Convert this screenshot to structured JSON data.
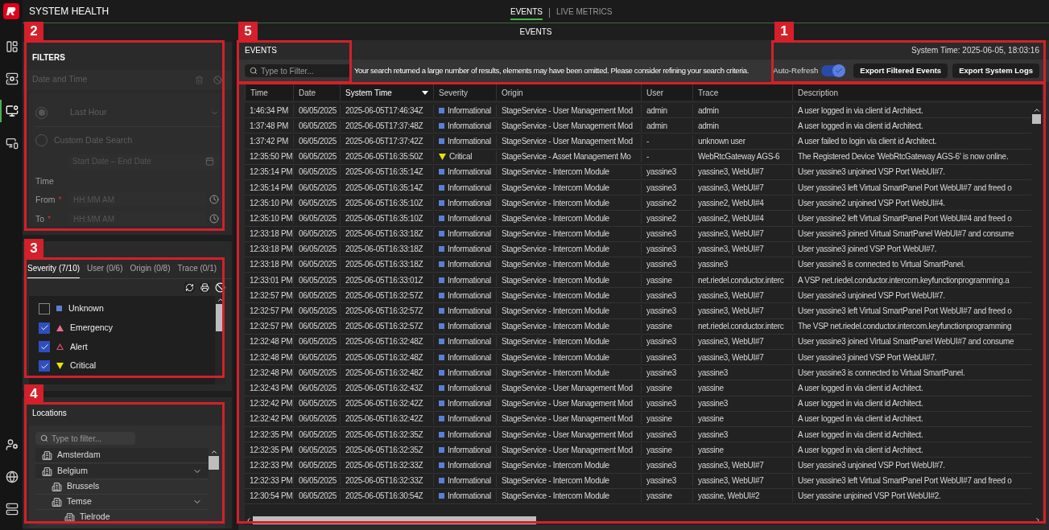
{
  "app": {
    "title": "SYSTEM HEALTH"
  },
  "nav_rail": {
    "top": [
      {
        "selected": false
      },
      {
        "selected": false
      },
      {
        "selected": true
      },
      {
        "selected": false
      }
    ],
    "bottom": [
      {
        "selected": false
      },
      {
        "selected": false
      },
      {
        "selected": false
      }
    ]
  },
  "top_tabs": [
    {
      "label": "EVENTS",
      "selected": true
    },
    {
      "label": "LIVE METRICS",
      "selected": false
    }
  ],
  "section_bar": {
    "title": "EVENTS"
  },
  "filters": {
    "title": "FILTERS",
    "date_time": {
      "label": "Date and Time",
      "disabled": true,
      "options": [
        {
          "label": "Last Hour",
          "selected": true,
          "kind": "dropdown"
        },
        {
          "label": "Custom Date Search",
          "selected": false,
          "kind": "plain"
        }
      ],
      "date_range": {
        "placeholder": "Start Date – End Date"
      },
      "time_label": "Time",
      "from": {
        "label": "From",
        "required_mark": "*",
        "placeholder": "HH:MM AM"
      },
      "to": {
        "label": "To",
        "required_mark": "*",
        "placeholder": "HH:MM AM"
      }
    }
  },
  "severity_filter": {
    "tabs": [
      {
        "label": "Severity (7/10)",
        "selected": true
      },
      {
        "label": "User (0/6)",
        "selected": false
      },
      {
        "label": "Origin (0/8)",
        "selected": false
      },
      {
        "label": "Trace (0/1)",
        "selected": false
      }
    ],
    "items": [
      {
        "label": "Unknown",
        "checked": false,
        "kind": "square",
        "color": "#5b7fd6"
      },
      {
        "label": "Emergency",
        "checked": true,
        "kind": "triangle",
        "color": "#f06a8a"
      },
      {
        "label": "Alert",
        "checked": true,
        "kind": "triangle-outline",
        "color": "#e0506a"
      },
      {
        "label": "Critical",
        "checked": true,
        "kind": "triangle-down",
        "color": "#e6e600"
      }
    ]
  },
  "locations": {
    "title": "Locations",
    "search": {
      "placeholder": "Type to filter..."
    },
    "tree": [
      {
        "label": "Amsterdam",
        "expanded": false
      },
      {
        "label": "Belgium",
        "expanded": true,
        "children": [
          {
            "label": "Brussels",
            "expanded": false
          },
          {
            "label": "Temse",
            "expanded": true,
            "children": [
              {
                "label": "Tielrode",
                "expanded": false
              }
            ]
          }
        ]
      }
    ]
  },
  "events": {
    "title": "EVENTS",
    "system_time": "System Time: 2025-06-05, 18:03:16",
    "filter": {
      "placeholder": "Type to Filter..."
    },
    "warning": "Your search returned a large number of results, elements may have been omitted. Please consider refining your search criteria.",
    "auto_refresh": {
      "label": "Auto-Refresh",
      "on": true
    },
    "buttons": [
      "Export Filtered Events",
      "Export System Logs"
    ],
    "columns": [
      {
        "label": "Time",
        "sorted": false
      },
      {
        "label": "Date",
        "sorted": false
      },
      {
        "label": "System Time",
        "sorted": true
      },
      {
        "label": "Severity",
        "sorted": false
      },
      {
        "label": "Origin",
        "sorted": false
      },
      {
        "label": "User",
        "sorted": false
      },
      {
        "label": "Trace",
        "sorted": false
      },
      {
        "label": "Description",
        "sorted": false
      }
    ],
    "rows": [
      {
        "cells": [
          "1:46:34 PM",
          "06/05/2025",
          "2025-06-05T17:46:34Z",
          "Informational",
          "StageService - User Management Mod",
          "admin",
          "admin",
          "A user logged in via client id Architect."
        ],
        "kind": "square",
        "color": "#5b7fd6"
      },
      {
        "cells": [
          "1:37:48 PM",
          "06/05/2025",
          "2025-06-05T17:37:48Z",
          "Informational",
          "StageService - User Management Mod",
          "admin",
          "admin",
          "A user logged in via client id Architect."
        ],
        "kind": "square",
        "color": "#5b7fd6"
      },
      {
        "cells": [
          "1:37:42 PM",
          "06/05/2025",
          "2025-06-05T17:37:42Z",
          "Informational",
          "StageService - User Management Mod",
          "-",
          "unknown user",
          "A user failed to login via client id Architect."
        ],
        "kind": "square",
        "color": "#5b7fd6"
      },
      {
        "cells": [
          "12:35:50 PM",
          "06/05/2025",
          "2025-06-05T16:35:50Z",
          "Critical",
          "StageService - Asset Management Mo",
          "-",
          "WebRtcGateway AGS-6",
          "The Registered Device 'WebRtcGateway AGS-6' is now online."
        ],
        "kind": "triangle-down",
        "color": "#e6e600"
      },
      {
        "cells": [
          "12:35:14 PM",
          "06/05/2025",
          "2025-06-05T16:35:14Z",
          "Informational",
          "StageService - Intercom Module",
          "yassine3",
          "yassine3, WebUI#7",
          "User yassine3 unjoined VSP Port WebUI#7."
        ],
        "kind": "square",
        "color": "#5b7fd6"
      },
      {
        "cells": [
          "12:35:14 PM",
          "06/05/2025",
          "2025-06-05T16:35:14Z",
          "Informational",
          "StageService - Intercom Module",
          "yassine3",
          "yassine3, WebUI#7",
          "User yassine3 left Virtual SmartPanel Port WebUI#7 and freed o"
        ],
        "kind": "square",
        "color": "#5b7fd6"
      },
      {
        "cells": [
          "12:35:10 PM",
          "06/05/2025",
          "2025-06-05T16:35:10Z",
          "Informational",
          "StageService - Intercom Module",
          "yassine2",
          "yassine2, WebUI#4",
          "User yassine2 unjoined VSP Port WebUI#4."
        ],
        "kind": "square",
        "color": "#5b7fd6"
      },
      {
        "cells": [
          "12:35:10 PM",
          "06/05/2025",
          "2025-06-05T16:35:10Z",
          "Informational",
          "StageService - Intercom Module",
          "yassine2",
          "yassine2, WebUI#4",
          "User yassine2 left Virtual SmartPanel Port WebUI#4 and freed o"
        ],
        "kind": "square",
        "color": "#5b7fd6"
      },
      {
        "cells": [
          "12:33:18 PM",
          "06/05/2025",
          "2025-06-05T16:33:18Z",
          "Informational",
          "StageService - Intercom Module",
          "yassine3",
          "yassine3, WebUI#7",
          "User yassine3 joined Virtual SmartPanel WebUI#7 and consume"
        ],
        "kind": "square",
        "color": "#5b7fd6"
      },
      {
        "cells": [
          "12:33:18 PM",
          "06/05/2025",
          "2025-06-05T16:33:18Z",
          "Informational",
          "StageService - Intercom Module",
          "yassine3",
          "yassine3, WebUI#7",
          "User yassine3 joined VSP Port WebUI#7."
        ],
        "kind": "square",
        "color": "#5b7fd6"
      },
      {
        "cells": [
          "12:33:18 PM",
          "06/05/2025",
          "2025-06-05T16:33:18Z",
          "Informational",
          "StageService - Intercom Module",
          "yassine3",
          "yassine3",
          "User yassine3 is connected to Virtual SmartPanel."
        ],
        "kind": "square",
        "color": "#5b7fd6"
      },
      {
        "cells": [
          "12:33:01 PM",
          "06/05/2025",
          "2025-06-05T16:33:01Z",
          "Informational",
          "StageService - Intercom Module",
          "yassine",
          "net.riedel.conductor.interc",
          "A VSP net.riedel.conductor.intercom.keyfunctionprogramming.a"
        ],
        "kind": "square",
        "color": "#5b7fd6"
      },
      {
        "cells": [
          "12:32:57 PM",
          "06/05/2025",
          "2025-06-05T16:32:57Z",
          "Informational",
          "StageService - Intercom Module",
          "yassine3",
          "yassine3, WebUI#7",
          "User yassine3 unjoined VSP Port WebUI#7."
        ],
        "kind": "square",
        "color": "#5b7fd6"
      },
      {
        "cells": [
          "12:32:57 PM",
          "06/05/2025",
          "2025-06-05T16:32:57Z",
          "Informational",
          "StageService - Intercom Module",
          "yassine3",
          "yassine3, WebUI#7",
          "User yassine3 left Virtual SmartPanel Port WebUI#7 and freed o"
        ],
        "kind": "square",
        "color": "#5b7fd6"
      },
      {
        "cells": [
          "12:32:57 PM",
          "06/05/2025",
          "2025-06-05T16:32:57Z",
          "Informational",
          "StageService - Intercom Module",
          "yassine",
          "net.riedel.conductor.interc",
          "The VSP net.riedel.conductor.intercom.keyfunctionprogramming"
        ],
        "kind": "square",
        "color": "#5b7fd6"
      },
      {
        "cells": [
          "12:32:48 PM",
          "06/05/2025",
          "2025-06-05T16:32:48Z",
          "Informational",
          "StageService - Intercom Module",
          "yassine3",
          "yassine3, WebUI#7",
          "User yassine3 joined Virtual SmartPanel WebUI#7 and consume"
        ],
        "kind": "square",
        "color": "#5b7fd6"
      },
      {
        "cells": [
          "12:32:48 PM",
          "06/05/2025",
          "2025-06-05T16:32:48Z",
          "Informational",
          "StageService - Intercom Module",
          "yassine3",
          "yassine3, WebUI#7",
          "User yassine3 joined VSP Port WebUI#7."
        ],
        "kind": "square",
        "color": "#5b7fd6"
      },
      {
        "cells": [
          "12:32:48 PM",
          "06/05/2025",
          "2025-06-05T16:32:48Z",
          "Informational",
          "StageService - Intercom Module",
          "yassine3",
          "yassine3",
          "User yassine3 is connected to Virtual SmartPanel."
        ],
        "kind": "square",
        "color": "#5b7fd6"
      },
      {
        "cells": [
          "12:32:43 PM",
          "06/05/2025",
          "2025-06-05T16:32:43Z",
          "Informational",
          "StageService - User Management Mod",
          "yassine",
          "yassine",
          "A user logged in via client id Architect."
        ],
        "kind": "square",
        "color": "#5b7fd6"
      },
      {
        "cells": [
          "12:32:42 PM",
          "06/05/2025",
          "2025-06-05T16:32:42Z",
          "Informational",
          "StageService - User Management Mod",
          "yassine3",
          "yassine3",
          "A user logged in via client id Architect."
        ],
        "kind": "square",
        "color": "#5b7fd6"
      },
      {
        "cells": [
          "12:32:42 PM",
          "06/05/2025",
          "2025-06-05T16:32:42Z",
          "Informational",
          "StageService - User Management Mod",
          "yassine",
          "yassine",
          "A user logged in via client id Architect."
        ],
        "kind": "square",
        "color": "#5b7fd6"
      },
      {
        "cells": [
          "12:32:35 PM",
          "06/05/2025",
          "2025-06-05T16:32:35Z",
          "Informational",
          "StageService - User Management Mod",
          "yassine3",
          "yassine3",
          "A user logged in via client id Architect."
        ],
        "kind": "square",
        "color": "#5b7fd6"
      },
      {
        "cells": [
          "12:32:35 PM",
          "06/05/2025",
          "2025-06-05T16:32:35Z",
          "Informational",
          "StageService - User Management Mod",
          "yassine",
          "yassine",
          "A user logged in via client id Architect."
        ],
        "kind": "square",
        "color": "#5b7fd6"
      },
      {
        "cells": [
          "12:32:33 PM",
          "06/05/2025",
          "2025-06-05T16:32:33Z",
          "Informational",
          "StageService - Intercom Module",
          "yassine3",
          "yassine3, WebUI#7",
          "User yassine3 unjoined VSP Port WebUI#7."
        ],
        "kind": "square",
        "color": "#5b7fd6"
      },
      {
        "cells": [
          "12:32:33 PM",
          "06/05/2025",
          "2025-06-05T16:32:33Z",
          "Informational",
          "StageService - Intercom Module",
          "yassine3",
          "yassine3, WebUI#7",
          "User yassine3 left Virtual SmartPanel Port WebUI#7 and freed o"
        ],
        "kind": "square",
        "color": "#5b7fd6"
      },
      {
        "cells": [
          "12:30:54 PM",
          "06/05/2025",
          "2025-06-05T16:30:54Z",
          "Informational",
          "StageService - Intercom Module",
          "yassine",
          "yassine, WebUI#2",
          "User yassine unjoined VSP Port WebUI#2."
        ],
        "kind": "square",
        "color": "#5b7fd6"
      }
    ]
  },
  "callouts": [
    {
      "label": "2"
    },
    {
      "label": "5"
    },
    {
      "label": "1"
    },
    {
      "label": "3"
    },
    {
      "label": "4"
    }
  ]
}
